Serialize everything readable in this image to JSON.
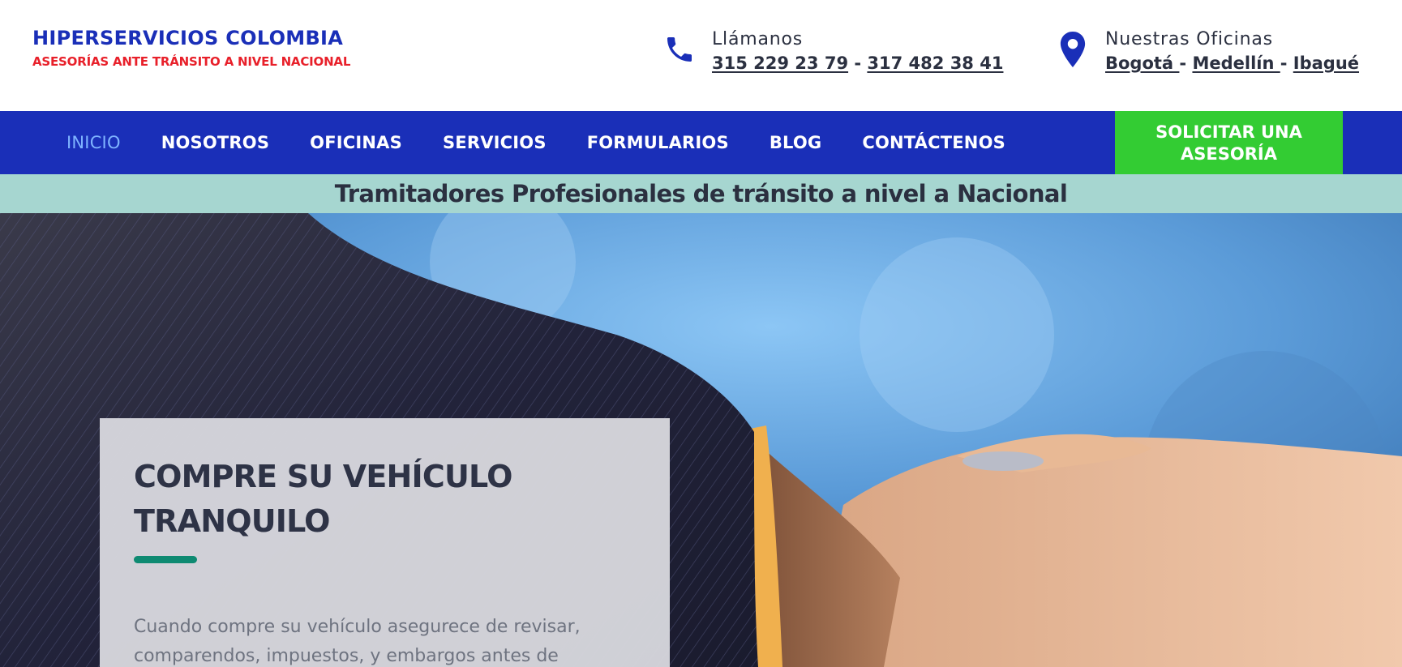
{
  "brand": {
    "title": "HIPERSERVICIOS COLOMBIA",
    "subtitle": "ASESORÍAS ANTE TRÁNSITO A NIVEL NACIONAL"
  },
  "phone": {
    "icon": "phone-icon",
    "label": "Llámanos",
    "numbers": [
      "315 229 23 79",
      "317 482 38 41"
    ],
    "separator": " - "
  },
  "offices": {
    "icon": "map-pin-icon",
    "label": "Nuestras Oficinas",
    "cities": [
      "Bogotá ",
      "Medellín ",
      "Ibagué"
    ],
    "separator": "- "
  },
  "nav": {
    "items": [
      "INICIO",
      "NOSOTROS",
      "OFICINAS",
      "SERVICIOS",
      "FORMULARIOS",
      "BLOG",
      "CONTÁCTENOS"
    ],
    "active_index": 0,
    "cta_line1": "SOLICITAR UNA",
    "cta_line2": "ASESORÍA"
  },
  "tagline": "Tramitadores Profesionales de tránsito a nivel a Nacional",
  "hero": {
    "heading": "COMPRE SU VEHÍCULO TRANQUILO",
    "body": "Cuando compre su vehículo asegurece de revisar, comparendos, impuestos, y embargos antes de"
  },
  "colors": {
    "brand_blue": "#1a2fb8",
    "brand_red": "#e8202a",
    "cta_green": "#33cc33",
    "strip_teal": "#a6d6d0",
    "accent_teal": "#0e8a72"
  }
}
